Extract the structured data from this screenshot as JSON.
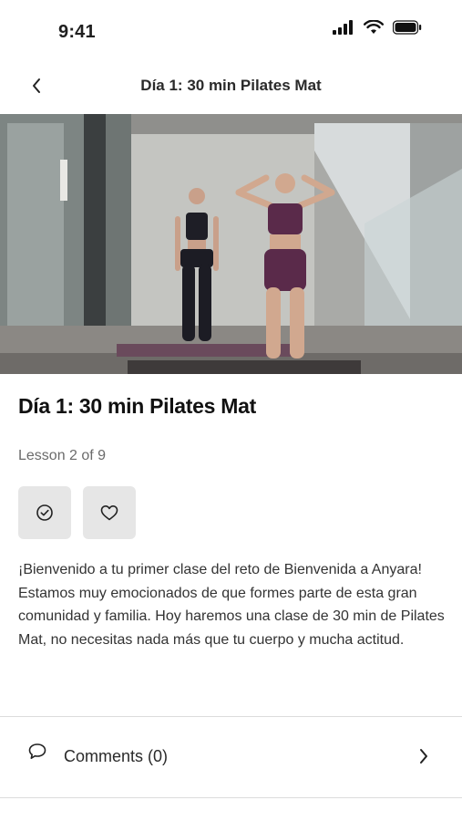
{
  "status_bar": {
    "time": "9:41"
  },
  "nav": {
    "title": "Día 1: 30 min Pilates Mat"
  },
  "lesson": {
    "title": "Día 1: 30 min Pilates Mat",
    "progress": "Lesson 2 of 9",
    "description": [
      "¡Bienvenido a tu primer clase del reto de Bienvenida a Anyara!",
      "Estamos muy emocionados de que formes parte de esta gran comunidad y familia. Hoy haremos una clase de 30 min de Pilates Mat, no necesitas nada más que tu cuerpo y mucha actitud."
    ]
  },
  "comments": {
    "label": "Comments (0)"
  },
  "icons": {
    "back": "chevron-left-icon",
    "complete": "check-circle-icon",
    "favorite": "heart-icon",
    "comments": "chat-bubble-icon",
    "comments_chevron": "chevron-right-icon"
  }
}
